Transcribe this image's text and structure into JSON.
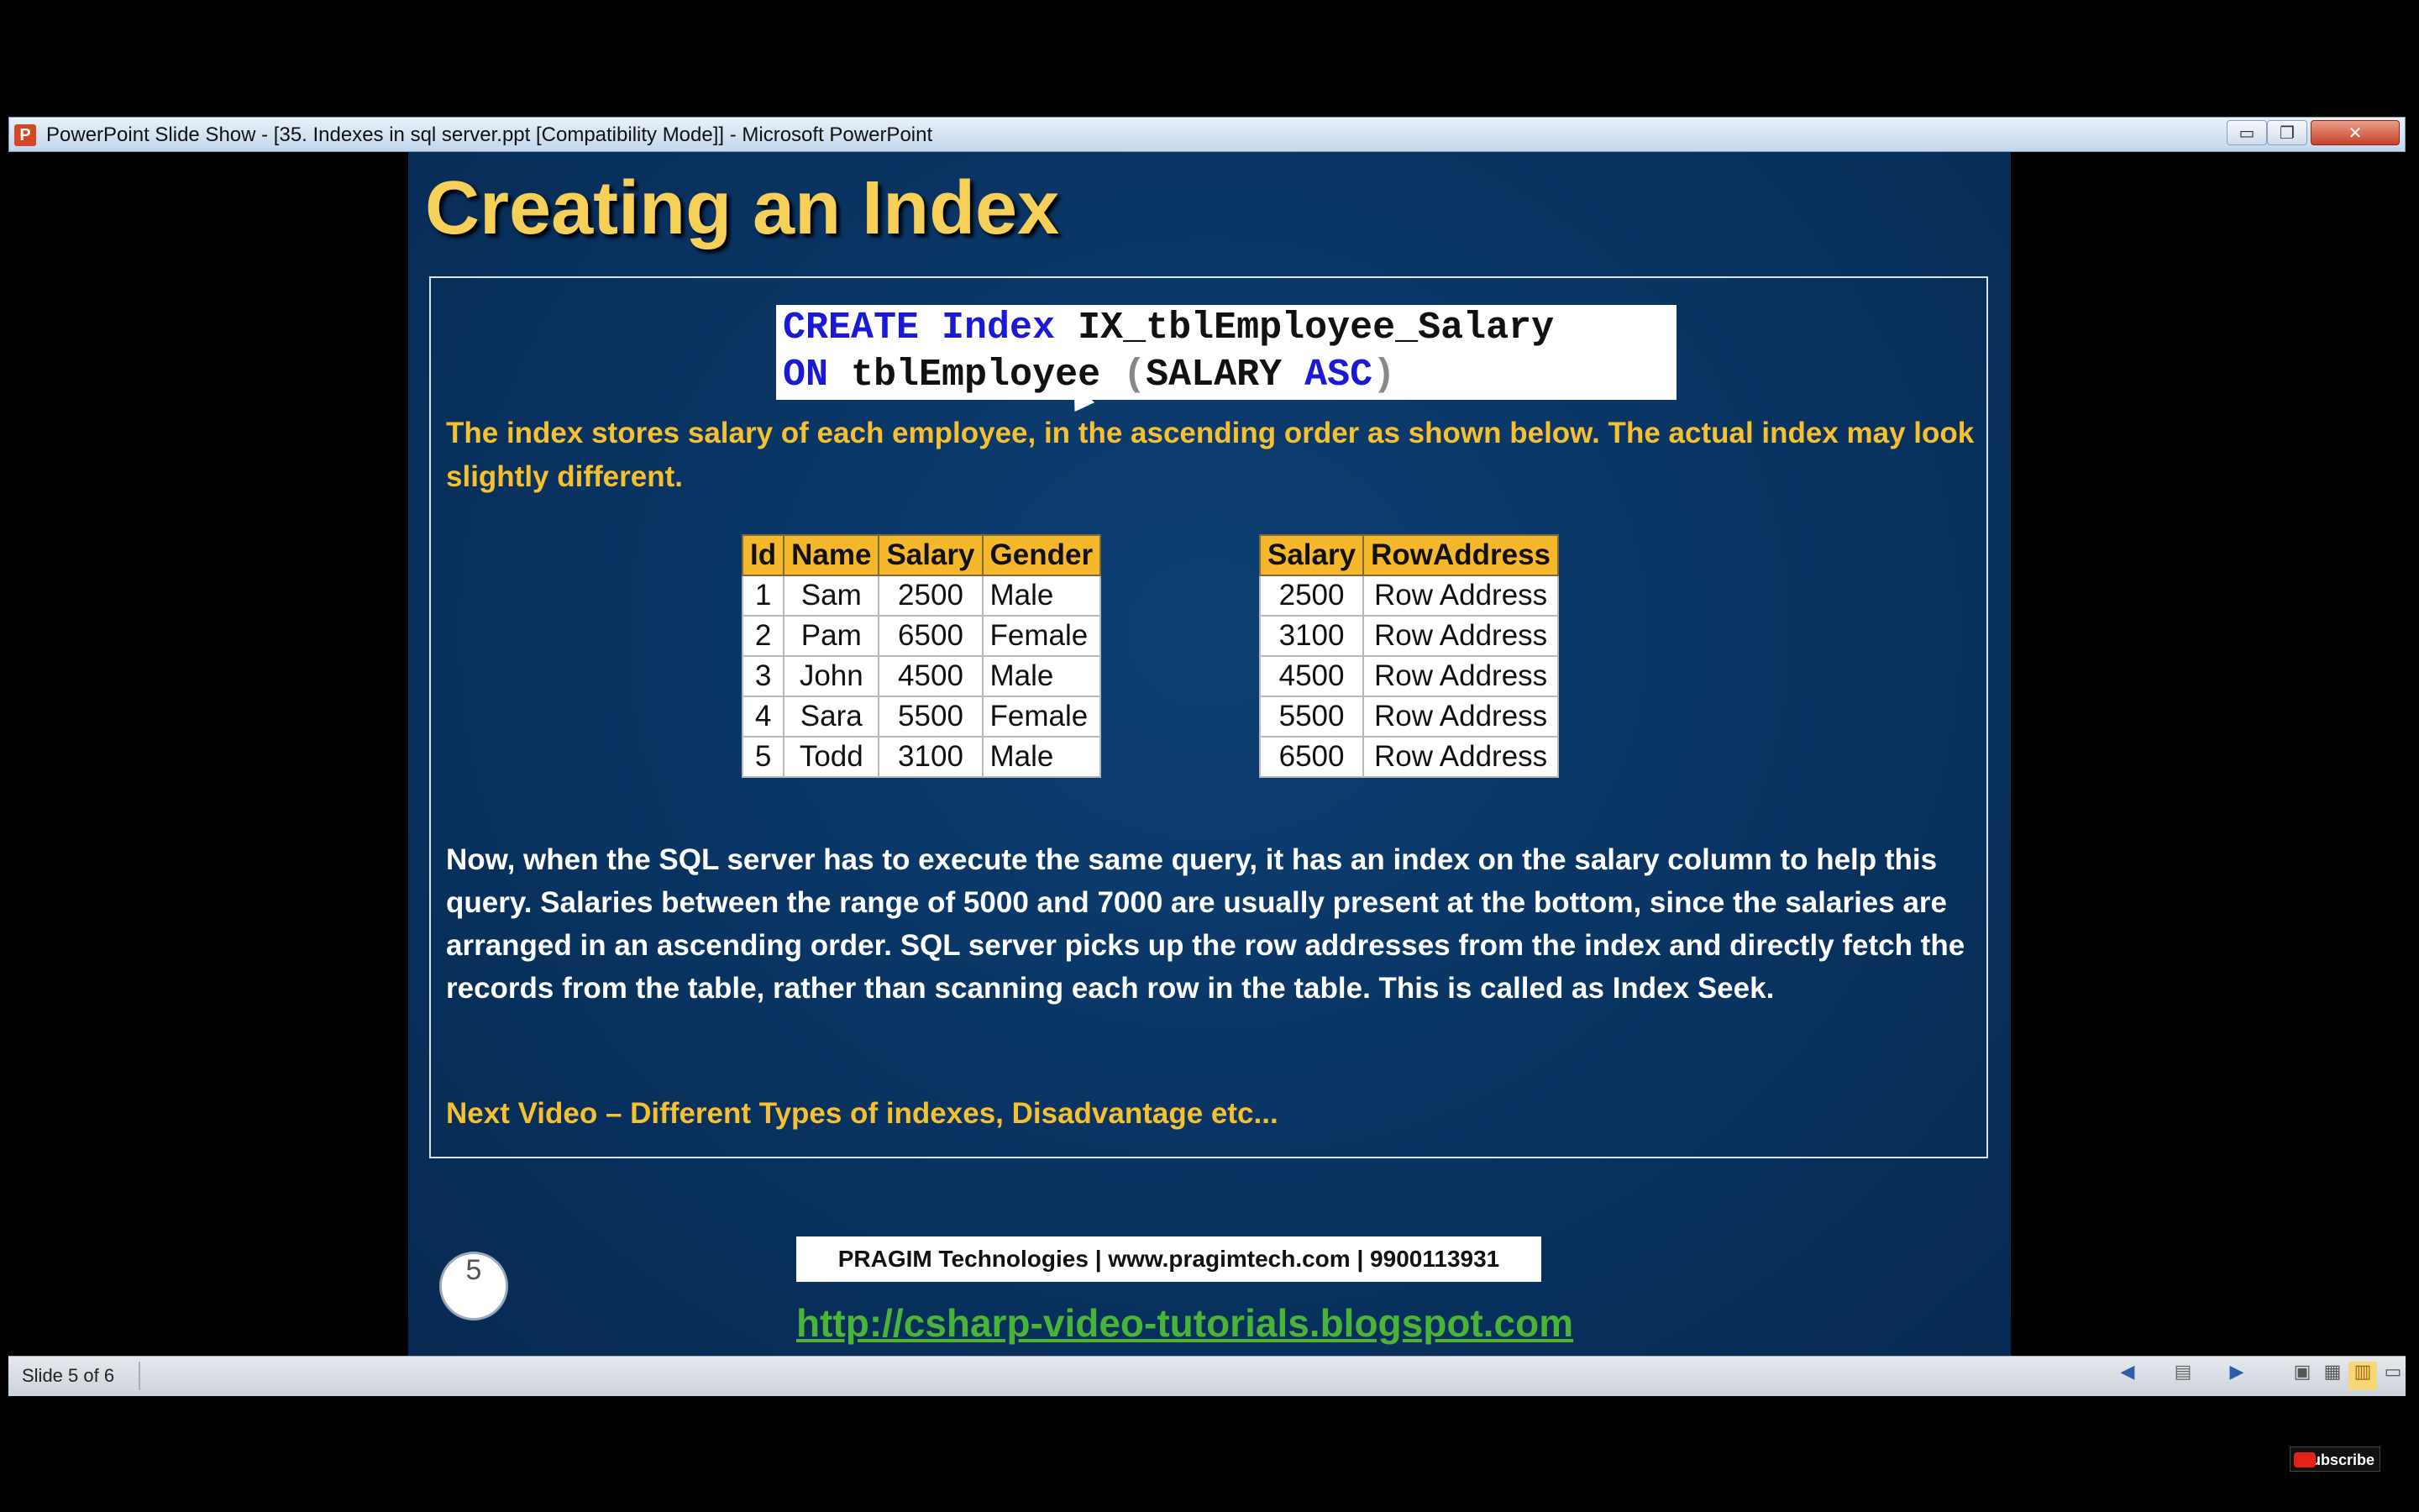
{
  "window": {
    "app_icon": "P",
    "title": "PowerPoint Slide Show - [35. Indexes in sql server.ppt [Compatibility Mode]] - Microsoft PowerPoint",
    "minimize": "▭",
    "maximize": "❐",
    "close": "✕"
  },
  "slide": {
    "title": "Creating an Index",
    "code": {
      "line1_kw1": "CREATE",
      "line1_kw2": "Index",
      "line1_rest": "IX_tblEmployee_Salary",
      "line2_kw1": "ON",
      "line2_rest": "tblEmployee",
      "line2_paren_open": "(",
      "line2_col": "SALARY",
      "line2_kw2": "ASC",
      "line2_paren_close": ")"
    },
    "intro": "The index stores salary of each employee, in the ascending order as shown below. The actual index may look slightly different.",
    "employee_table": {
      "headers": [
        "Id",
        "Name",
        "Salary",
        "Gender"
      ],
      "rows": [
        [
          "1",
          "Sam",
          "2500",
          "Male"
        ],
        [
          "2",
          "Pam",
          "6500",
          "Female"
        ],
        [
          "3",
          "John",
          "4500",
          "Male"
        ],
        [
          "4",
          "Sara",
          "5500",
          "Female"
        ],
        [
          "5",
          "Todd",
          "3100",
          "Male"
        ]
      ]
    },
    "index_table": {
      "headers": [
        "Salary",
        "RowAddress"
      ],
      "rows": [
        [
          "2500",
          "Row Address"
        ],
        [
          "3100",
          "Row Address"
        ],
        [
          "4500",
          "Row Address"
        ],
        [
          "5500",
          "Row Address"
        ],
        [
          "6500",
          "Row Address"
        ]
      ]
    },
    "explanation": "Now, when the SQL server has to execute the same query, it has an index on the salary column to help this query. Salaries between the range of 5000 and 7000 are usually present at the bottom, since the salaries are arranged in an ascending order. SQL server picks up the row addresses from the index and directly fetch the records from the table, rather than scanning each row in the table. This is called as Index Seek.",
    "next_video": "Next Video – Different Types of indexes, Disadvantage etc...",
    "slide_number": "5",
    "company": "PRAGIM Technologies | www.pragimtech.com | 9900113931",
    "blog_link": "http://csharp-video-tutorials.blogspot.com"
  },
  "status": {
    "slide_status": "Slide 5 of 6",
    "icons": [
      "previous-icon",
      "slide-menu-icon",
      "next-icon",
      "normal-view-icon",
      "slide-sorter-icon",
      "reading-view-icon",
      "slide-show-icon"
    ]
  },
  "overlay": {
    "subscribe": "Subscribe"
  }
}
